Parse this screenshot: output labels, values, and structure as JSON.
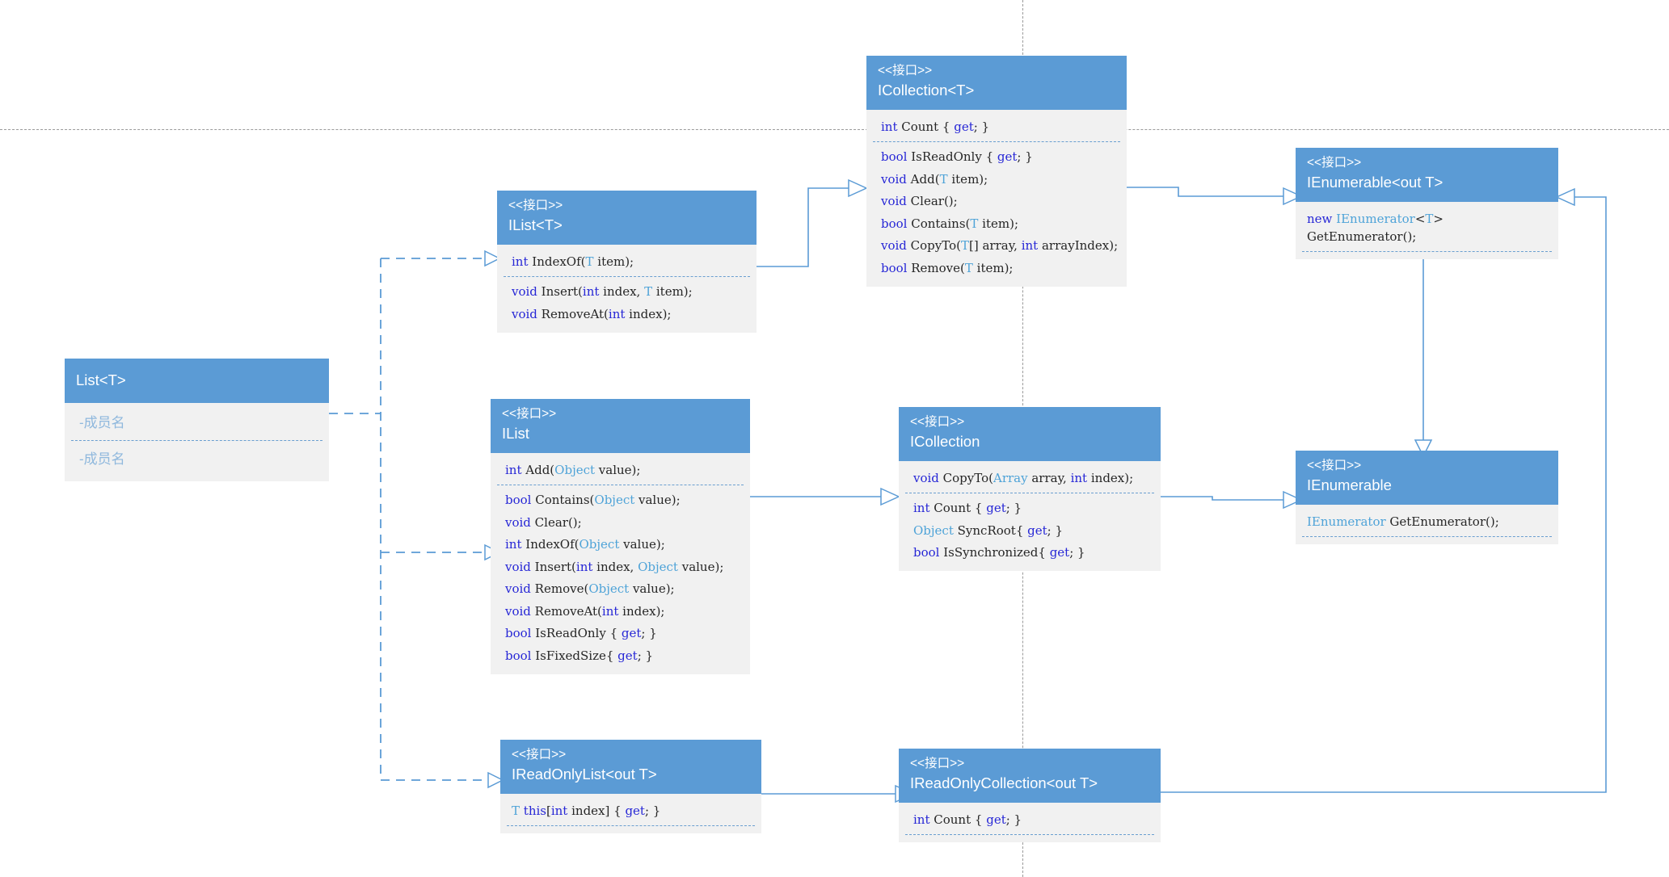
{
  "diagram": {
    "title": "List<T> interface hierarchy UML class diagram",
    "stereotype_label": "<<接口>>",
    "accent_color": "#5b9bd5",
    "body_color": "#f1f1f1",
    "guide_color": "#9a9a9a"
  },
  "boxes": {
    "list_t": {
      "name": "List<T>",
      "stereotype": "",
      "members": [
        "-成员名",
        "-成员名"
      ],
      "separator_after": 0
    },
    "ilist_t": {
      "name": "IList<T>",
      "stereotype": "<<接口>>",
      "members": [
        "int IndexOf(T item);",
        "void Insert(int index, T item);",
        "void RemoveAt(int index);"
      ],
      "separator_after": 0
    },
    "icollection_t": {
      "name": "ICollection<T>",
      "stereotype": "<<接口>>",
      "members": [
        "int Count { get; }",
        "bool IsReadOnly { get; }",
        "void Add(T item);",
        "void Clear();",
        "bool Contains(T item);",
        "void CopyTo(T[] array, int arrayIndex);",
        "bool Remove(T item);"
      ],
      "separator_after": 0
    },
    "ienumerable_t": {
      "name": "IEnumerable<out T>",
      "stereotype": "<<接口>>",
      "members": [
        "new IEnumerator<T> GetEnumerator();"
      ],
      "separator_after": 0
    },
    "ilist": {
      "name": "IList",
      "stereotype": "<<接口>>",
      "members": [
        "int Add(Object value);",
        "bool Contains(Object value);",
        "void Clear();",
        "int IndexOf(Object value);",
        "void Insert(int index, Object value);",
        "void Remove(Object value);",
        "void RemoveAt(int index);",
        "bool IsReadOnly { get; }",
        "bool IsFixedSize{ get; }"
      ],
      "separator_after": 0
    },
    "icollection": {
      "name": "ICollection",
      "stereotype": "<<接口>>",
      "members": [
        "void CopyTo(Array array, int index);",
        "int Count { get; }",
        "Object SyncRoot{ get; }",
        "bool IsSynchronized{ get; }"
      ],
      "separator_after": 0
    },
    "ienumerable": {
      "name": "IEnumerable",
      "stereotype": "<<接口>>",
      "members": [
        "IEnumerator GetEnumerator();"
      ],
      "separator_after": 0
    },
    "ireadonlylist_t": {
      "name": "IReadOnlyList<out T>",
      "stereotype": "<<接口>>",
      "members": [
        "T this[int index] { get; }"
      ],
      "separator_after": 0
    },
    "ireadonlycollection_t": {
      "name": "IReadOnlyCollection<out T>",
      "stereotype": "<<接口>>",
      "members": [
        "int Count { get; }"
      ],
      "separator_after": 0
    }
  },
  "relations": [
    {
      "from": "List<T>",
      "to": "IList<T>",
      "kind": "realization"
    },
    {
      "from": "List<T>",
      "to": "IList",
      "kind": "realization"
    },
    {
      "from": "List<T>",
      "to": "IReadOnlyList<out T>",
      "kind": "realization"
    },
    {
      "from": "IList<T>",
      "to": "ICollection<T>",
      "kind": "generalization"
    },
    {
      "from": "ICollection<T>",
      "to": "IEnumerable<out T>",
      "kind": "generalization"
    },
    {
      "from": "IList",
      "to": "ICollection",
      "kind": "generalization"
    },
    {
      "from": "ICollection",
      "to": "IEnumerable",
      "kind": "generalization"
    },
    {
      "from": "IEnumerable<out T>",
      "to": "IEnumerable",
      "kind": "generalization"
    },
    {
      "from": "IReadOnlyList<out T>",
      "to": "IReadOnlyCollection<out T>",
      "kind": "generalization"
    },
    {
      "from": "IReadOnlyCollection<out T>",
      "to": "IEnumerable<out T>",
      "kind": "generalization"
    }
  ]
}
